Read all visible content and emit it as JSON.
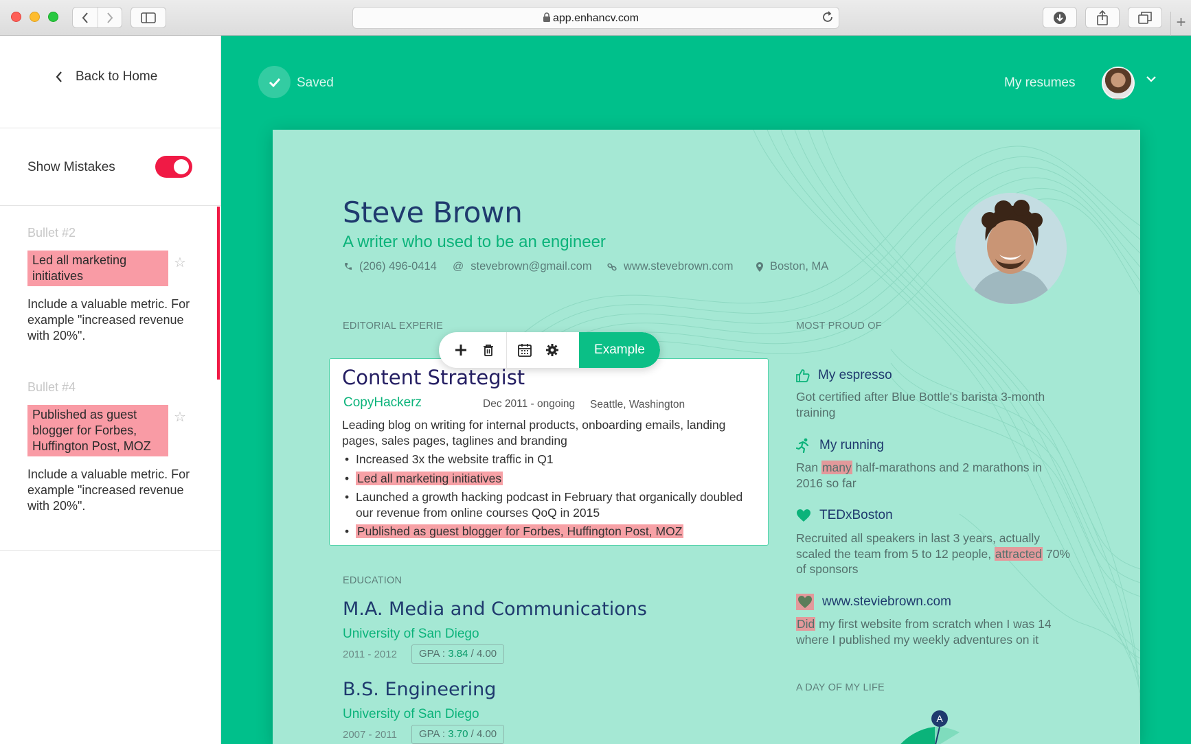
{
  "browser": {
    "url": "app.enhancv.com"
  },
  "left_panel": {
    "back_label": "Back to Home",
    "show_mistakes_label": "Show Mistakes",
    "show_mistakes_on": true,
    "mistakes": [
      {
        "title": "Bullet #2",
        "highlight": "Led all marketing initiatives",
        "tip": "Include a valuable metric. For example \"increased revenue with 20%\"."
      },
      {
        "title": "Bullet #4",
        "highlight": "Published as guest blogger for Forbes, Huffington Post, MOZ",
        "tip": "Include a valuable metric. For example \"increased revenue with 20%\"."
      }
    ]
  },
  "header": {
    "saved_label": "Saved",
    "my_resumes_label": "My resumes"
  },
  "resume": {
    "name": "Steve Brown",
    "tagline": "A writer who used to be an engineer",
    "contact": {
      "phone": "(206) 496-0414",
      "email": "stevebrown@gmail.com",
      "website": "www.stevebrown.com",
      "location": "Boston, MA"
    },
    "experience_heading": "EDITORIAL EXPERIE",
    "toolbar": {
      "example_label": "Example"
    },
    "experience": {
      "title": "Content Strategist",
      "company": "CopyHackerz",
      "dates": "Dec 2011 - ongoing",
      "location": "Seattle, Washington",
      "description": "Leading blog on writing for internal products, onboarding emails, landing pages, sales pages, taglines and branding",
      "bullets": [
        {
          "text": "Increased 3x the website traffic in Q1",
          "mistake": false
        },
        {
          "text": "Led all marketing initiatives",
          "mistake": true
        },
        {
          "text": "Launched a growth hacking podcast in February that organically doubled our revenue from online courses QoQ in 2015",
          "mistake": false
        },
        {
          "text": "Published as guest blogger for Forbes, Huffington Post, MOZ",
          "mistake": true
        }
      ]
    },
    "education_heading": "EDUCATION",
    "education": [
      {
        "degree": "M.A. Media and Communications",
        "school": "University of San Diego",
        "years": "2011 - 2012",
        "gpa_label": "GPA :",
        "gpa": "3.84",
        "gpa_max": "/ 4.00"
      },
      {
        "degree": "B.S. Engineering",
        "school": "University of San Diego",
        "years": "2007 - 2011",
        "gpa_label": "GPA :",
        "gpa": "3.70",
        "gpa_max": "/ 4.00"
      }
    ],
    "proud_heading": "MOST PROUD OF",
    "proud": [
      {
        "icon": "thumbs-up-icon",
        "title": "My espresso",
        "text": "Got certified after Blue Bottle's barista 3-month training"
      },
      {
        "icon": "running-icon",
        "title": "My running",
        "text_before": "Ran ",
        "text_hl": "many",
        "text_after": " half-marathons and 2 marathons in 2016 so far"
      },
      {
        "icon": "heart-icon",
        "title": "TEDxBoston",
        "text_before": "Recruited all speakers in last 3 years, actually scaled the team from 5 to 12 people, ",
        "text_hl": "attracted",
        "text_after": " 70% of sponsors"
      },
      {
        "icon": "heart-icon",
        "title": "www.steviebrown.com",
        "text_hl": "Did",
        "text_after": " my first website from scratch when I was 14 where I published my weekly adventures on it"
      }
    ],
    "day_heading": "A DAY OF MY LIFE",
    "day_marker": "A"
  },
  "colors": {
    "accent": "#00c08b",
    "resume_bg": "#a5e8d4",
    "mistake": "#f01a45",
    "mistake_highlight": "#f99ba5",
    "title_navy": "#1f3a6e"
  }
}
